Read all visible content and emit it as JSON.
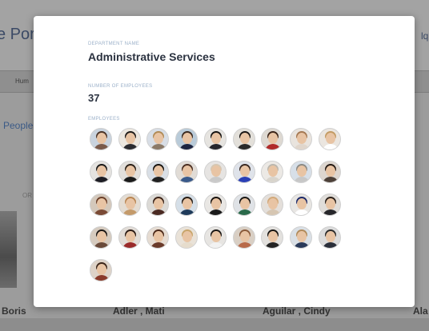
{
  "background": {
    "title": "e Port",
    "title_right": "lqu",
    "nav_label": "Hum",
    "people_link": "People",
    "or_text": "OR",
    "names": [
      "Boris",
      "Adler , Mati",
      "Aguilar , Cindy",
      "Ala"
    ]
  },
  "modal": {
    "department_label": "DEPARTMENT NAME",
    "department_name": "Administrative Services",
    "employees_count_label": "NUMBER OF EMPLOYEES",
    "employees_count": "37",
    "employees_label": "EMPLOYEES",
    "employees": [
      {
        "bg": "#c9d3de",
        "hair": "#4a3326",
        "shirt": "#7a5a4a"
      },
      {
        "bg": "#ece7df",
        "hair": "#1e1a18",
        "shirt": "#2b2b30"
      },
      {
        "bg": "#d8dee6",
        "hair": "#b08a55",
        "shirt": "#8b7a68"
      },
      {
        "bg": "#b9cbd9",
        "hair": "#3a2a20",
        "shirt": "#1c2440"
      },
      {
        "bg": "#e6e4e0",
        "hair": "#161412",
        "shirt": "#26262c"
      },
      {
        "bg": "#e3e0da",
        "hair": "#1a1614",
        "shirt": "#2a2a2a"
      },
      {
        "bg": "#ded9d2",
        "hair": "#3b2418",
        "shirt": "#b02a2a"
      },
      {
        "bg": "#e9e4de",
        "hair": "#a47852",
        "shirt": "#e0d6cc"
      },
      {
        "bg": "#ebe6e0",
        "hair": "#c29a62",
        "shirt": "#ffffff"
      },
      {
        "bg": "#e5e3e0",
        "hair": "#1a1a1a",
        "shirt": "#1d1d24"
      },
      {
        "bg": "#e2dfdb",
        "hair": "#2a2018",
        "shirt": "#1a1a1a"
      },
      {
        "bg": "#d9dfe6",
        "hair": "#181410",
        "shirt": "#202020"
      },
      {
        "bg": "#e1dcd6",
        "hair": "#4a2e22",
        "shirt": "#3a5a8a"
      },
      {
        "bg": "#e6e4e2",
        "hair": "#d6c7b2",
        "shirt": "#c9c9c9"
      },
      {
        "bg": "#dfe3ea",
        "hair": "#3a2a22",
        "shirt": "#2a3fb5"
      },
      {
        "bg": "#ece9e5",
        "hair": "#bcb7ae",
        "shirt": "#d8d4cc"
      },
      {
        "bg": "#d7dfe8",
        "hair": "#8c8a85",
        "shirt": "#c7c7c7"
      },
      {
        "bg": "#ddd6cf",
        "hair": "#241a14",
        "shirt": "#4c4038"
      },
      {
        "bg": "#d4c8bb",
        "hair": "#6a3f2a",
        "shirt": "#7a4a35"
      },
      {
        "bg": "#e4dcd2",
        "hair": "#b88552",
        "shirt": "#c49a6a"
      },
      {
        "bg": "#dcdad6",
        "hair": "#3a2218",
        "shirt": "#4a2a22"
      },
      {
        "bg": "#d5dfe8",
        "hair": "#251c16",
        "shirt": "#1e3a5a"
      },
      {
        "bg": "#e9e7e4",
        "hair": "#1a1410",
        "shirt": "#1a1a1a"
      },
      {
        "bg": "#dfe2e6",
        "hair": "#1a1816",
        "shirt": "#2a6a4a"
      },
      {
        "bg": "#e4dfda",
        "hair": "#d2a97a",
        "shirt": "#d6c6b2"
      },
      {
        "bg": "#e8e6e3",
        "hair": "#1c2a6a",
        "shirt": "#ffffff"
      },
      {
        "bg": "#e0ddd9",
        "hair": "#2a201a",
        "shirt": "#26262a"
      },
      {
        "bg": "#d6cbbf",
        "hair": "#1a1614",
        "shirt": "#6a4a3a"
      },
      {
        "bg": "#e2dcd6",
        "hair": "#2a1a14",
        "shirt": "#9a2a2a"
      },
      {
        "bg": "#e6dcd2",
        "hair": "#4a2818",
        "shirt": "#6a3a2a"
      },
      {
        "bg": "#e9e2d8",
        "hair": "#c8a46a",
        "shirt": "#e6dccc"
      },
      {
        "bg": "#e7e5e2",
        "hair": "#1a1614",
        "shirt": "#f2f2f2"
      },
      {
        "bg": "#d9cfc4",
        "hair": "#8a5a3a",
        "shirt": "#b86a4a"
      },
      {
        "bg": "#e3e1de",
        "hair": "#161412",
        "shirt": "#242424"
      },
      {
        "bg": "#dae0e6",
        "hair": "#b08a5a",
        "shirt": "#2a3a5a"
      },
      {
        "bg": "#dcdcdc",
        "hair": "#2a2a2a",
        "shirt": "#2a2f3a"
      },
      {
        "bg": "#ded3c8",
        "hair": "#3a2418",
        "shirt": "#8a3a2a"
      }
    ]
  }
}
